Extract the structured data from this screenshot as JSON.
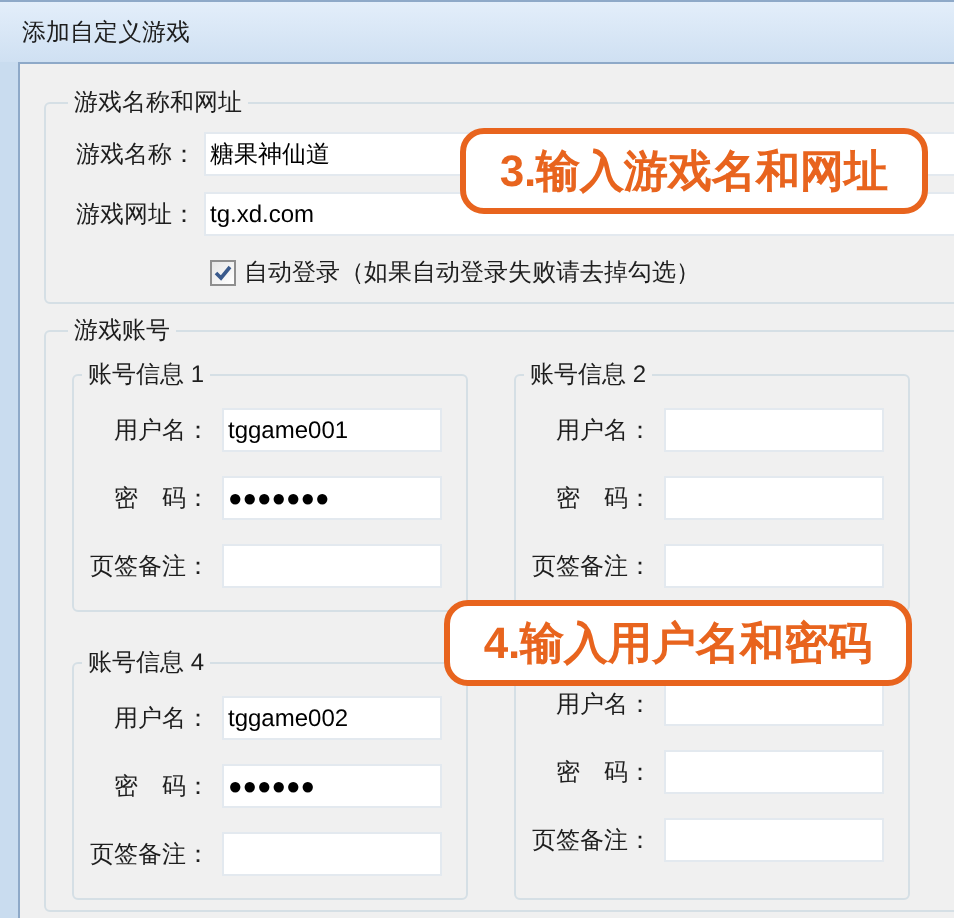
{
  "window": {
    "title": "添加自定义游戏"
  },
  "game_info": {
    "legend": "游戏名称和网址",
    "fields": [
      {
        "label": "游戏名称：",
        "value": "糖果神仙道"
      },
      {
        "label": "游戏网址：",
        "value": "tg.xd.com"
      }
    ],
    "auto_login": {
      "label": "自动登录（如果自动登录失败请去掉勾选）",
      "checked": true
    }
  },
  "accounts": {
    "legend": "游戏账号",
    "groups": [
      {
        "title": "账号信息 1",
        "fields": [
          {
            "label": "用户名：",
            "value": "tggame001"
          },
          {
            "label": "密　码：",
            "value": "●●●●●●●"
          },
          {
            "label": "页签备注："
          }
        ]
      },
      {
        "title": "账号信息 2",
        "fields": [
          {
            "label": "用户名："
          },
          {
            "label": "密　码："
          },
          {
            "label": "页签备注："
          }
        ]
      },
      {
        "title": "账号信息 4",
        "fields": [
          {
            "label": "用户名：",
            "value": "tggame002"
          },
          {
            "label": "密　码：",
            "value": "●●●●●●"
          },
          {
            "label": "页签备注："
          }
        ]
      },
      {
        "fields": [
          {
            "label": "用户名："
          },
          {
            "label": "密　码："
          },
          {
            "label": "页签备注："
          }
        ]
      }
    ]
  },
  "callouts": [
    {
      "text": "3.输入游戏名和网址"
    },
    {
      "text": "4.输入用户名和密码"
    }
  ]
}
